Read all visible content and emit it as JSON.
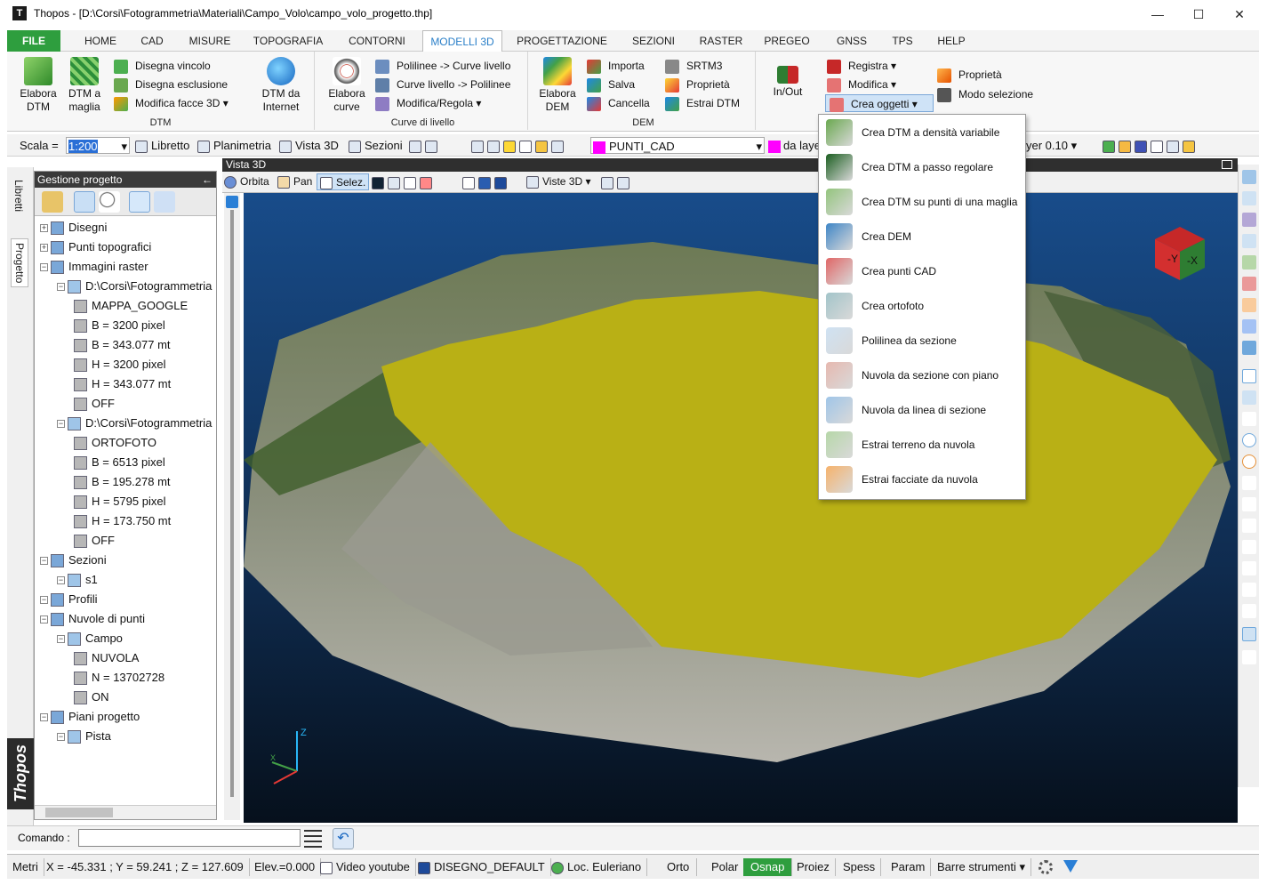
{
  "window": {
    "title": "Thopos - [D:\\Corsi\\Fotogrammetria\\Materiali\\Campo_Volo\\campo_volo_progetto.thp]",
    "min": "—",
    "max": "☐",
    "close": "✕"
  },
  "menu": [
    "FILE",
    "HOME",
    "CAD",
    "MISURE",
    "TOPOGRAFIA",
    "CONTORNI",
    "MODELLI 3D",
    "PROGETTAZIONE",
    "SEZIONI",
    "RASTER",
    "PREGEO",
    "GNSS",
    "TPS",
    "HELP"
  ],
  "ribbon": {
    "dtm": {
      "title": "DTM",
      "elabora": "Elabora DTM",
      "dtm_maglia": "DTM a maglia",
      "disegna_vincolo": "Disegna vincolo",
      "disegna_esclusione": "Disegna esclusione",
      "modifica_facce": "Modifica facce 3D",
      "dtm_internet": "DTM da Internet"
    },
    "curve": {
      "title": "Curve di livello",
      "elabora": "Elabora curve",
      "polilinee_curve": "Polilinee -> Curve livello",
      "curve_polilinee": "Curve livello -> Polilinee",
      "modifica_regola": "Modifica/Regola"
    },
    "dem": {
      "title": "DEM",
      "elabora": "Elabora DEM",
      "importa": "Importa",
      "salva": "Salva",
      "cancella": "Cancella",
      "srtm3": "SRTM3",
      "proprieta": "Proprietà",
      "estrai_dtm": "Estrai DTM"
    },
    "other": {
      "inout": "In/Out",
      "registra": "Registra",
      "modifica": "Modifica",
      "crea_oggetti": "Crea oggetti",
      "proprieta": "Proprietà",
      "modo_selezione": "Modo selezione"
    }
  },
  "toolbar2": {
    "scala_label": "Scala =",
    "scala_value": "1:200",
    "libretto": "Libretto",
    "planimetria": "Planimetria",
    "vista3d": "Vista 3D",
    "sezioni": "Sezioni",
    "layer": "PUNTI_CAD",
    "da_layer": "da layer",
    "layer_thick": "yer 0.10"
  },
  "sidetabs": {
    "libretti": "Libretti",
    "progetto": "Progetto",
    "logo": "Thopos"
  },
  "project_panel": {
    "title": "Gestione progetto"
  },
  "tree": [
    {
      "label": "Disegni",
      "level": 0
    },
    {
      "label": "Punti topografici",
      "level": 0
    },
    {
      "label": "Immagini raster",
      "level": 0
    },
    {
      "label": "D:\\Corsi\\Fotogrammetria",
      "level": 1
    },
    {
      "label": "MAPPA_GOOGLE",
      "level": 2
    },
    {
      "label": "B = 3200 pixel",
      "level": 2
    },
    {
      "label": "B = 343.077 mt",
      "level": 2
    },
    {
      "label": "H = 3200 pixel",
      "level": 2
    },
    {
      "label": "H = 343.077 mt",
      "level": 2
    },
    {
      "label": "OFF",
      "level": 2
    },
    {
      "label": "D:\\Corsi\\Fotogrammetria",
      "level": 1
    },
    {
      "label": "ORTOFOTO",
      "level": 2
    },
    {
      "label": "B = 6513 pixel",
      "level": 2
    },
    {
      "label": "B = 195.278 mt",
      "level": 2
    },
    {
      "label": "H = 5795 pixel",
      "level": 2
    },
    {
      "label": "H = 173.750 mt",
      "level": 2
    },
    {
      "label": "OFF",
      "level": 2
    },
    {
      "label": "Sezioni",
      "level": 0
    },
    {
      "label": "s1",
      "level": 1
    },
    {
      "label": "Profili",
      "level": 0
    },
    {
      "label": "Nuvole di punti",
      "level": 0
    },
    {
      "label": "Campo",
      "level": 1
    },
    {
      "label": "NUVOLA",
      "level": 2
    },
    {
      "label": "N = 13702728",
      "level": 2
    },
    {
      "label": "ON",
      "level": 2
    },
    {
      "label": "Piani progetto",
      "level": 0
    },
    {
      "label": "Pista",
      "level": 1
    }
  ],
  "view3d": {
    "title": "Vista 3D",
    "orbita": "Orbita",
    "pan": "Pan",
    "selez": "Selez.",
    "viste3d": "Viste 3D",
    "axis_z": "Z",
    "axis_x": "X",
    "cube_y": "-Y",
    "cube_x": "-X"
  },
  "dropdown": [
    "Crea DTM a densità variabile",
    "Crea DTM a passo regolare",
    "Crea DTM su punti di una maglia",
    "Crea DEM",
    "Crea punti CAD",
    "Crea ortofoto",
    "Polilinea da sezione",
    "Nuvola da sezione con piano",
    "Nuvola da linea di sezione",
    "Estrai terreno da nuvola",
    "Estrai facciate da nuvola"
  ],
  "command": {
    "label": "Comando :",
    "value": ""
  },
  "status": {
    "units": "Metri",
    "coords": "X = -45.331 ; Y = 59.241 ; Z = 127.609",
    "elev": "Elev.=0.000",
    "video": "Video youtube",
    "disegno": "DISEGNO_DEFAULT",
    "loc": "Loc. Euleriano",
    "orto": "Orto",
    "polar": "Polar",
    "osnap": "Osnap",
    "proiez": "Proiez",
    "spess": "Spess",
    "param": "Param",
    "barre": "Barre strumenti"
  }
}
